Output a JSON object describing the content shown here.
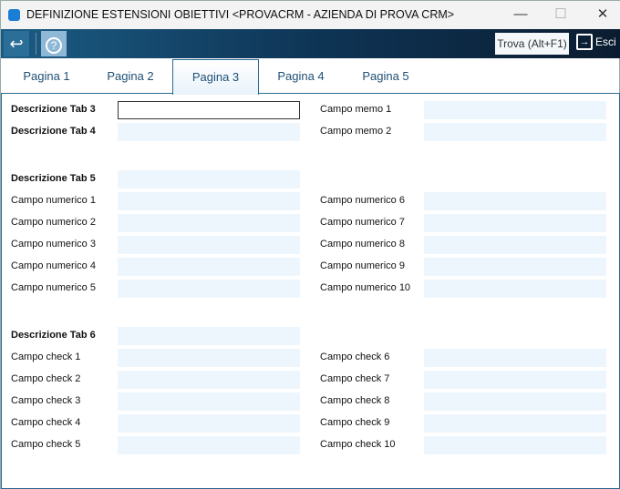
{
  "window": {
    "title": "DEFINIZIONE ESTENSIONI OBIETTIVI <PROVACRM - AZIENDA DI PROVA CRM>",
    "minimize": "—",
    "maximize": "☐",
    "close": "✕"
  },
  "toolbar": {
    "back": "↩",
    "help": "?",
    "find": "Trova (Alt+F1)",
    "exit": "Esci",
    "exit_icon": "→"
  },
  "tabs": [
    "Pagina 1",
    "Pagina 2",
    "Pagina 3",
    "Pagina 4",
    "Pagina 5"
  ],
  "active_tab": "Pagina 3",
  "form": {
    "tab3": "Descrizione Tab 3",
    "tab4": "Descrizione Tab 4",
    "memo1": "Campo memo 1",
    "memo2": "Campo memo 2",
    "tab5": "Descrizione Tab 5",
    "num": [
      "Campo numerico 1",
      "Campo numerico 2",
      "Campo numerico 3",
      "Campo numerico 4",
      "Campo numerico 5",
      "Campo numerico 6",
      "Campo numerico 7",
      "Campo numerico 8",
      "Campo numerico 9",
      "Campo numerico 10"
    ],
    "tab6": "Descrizione Tab 6",
    "check": [
      "Campo check 1",
      "Campo check 2",
      "Campo check 3",
      "Campo check 4",
      "Campo check 5",
      "Campo check 6",
      "Campo check 7",
      "Campo check 8",
      "Campo check 9",
      "Campo check 10"
    ]
  }
}
